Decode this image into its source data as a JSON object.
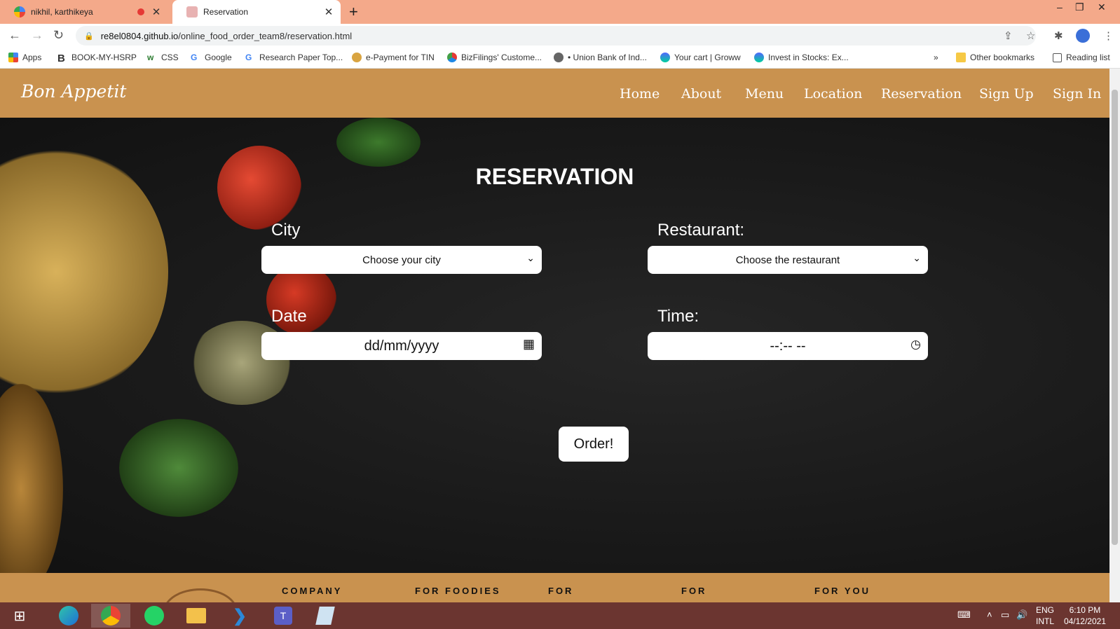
{
  "browser": {
    "tabs": [
      {
        "title": "nikhil, karthikeya",
        "favicon": "google-meet-icon",
        "recording": true
      },
      {
        "title": "Reservation",
        "favicon": "site-favicon-icon",
        "active": true
      }
    ],
    "url_host": "re8el0804.github.io",
    "url_path": "/online_food_order_team8/reservation.html",
    "bookmarks": [
      {
        "label": "Apps",
        "icon": "apps-grid-icon"
      },
      {
        "label": "BOOK-MY-HSRP",
        "icon": "b-logo-icon"
      },
      {
        "label": "CSS",
        "icon": "w3schools-icon"
      },
      {
        "label": "Google",
        "icon": "google-icon"
      },
      {
        "label": "Research Paper Top...",
        "icon": "google-icon"
      },
      {
        "label": "e-Payment for TIN",
        "icon": "tin-icon"
      },
      {
        "label": "BizFilings' Custome...",
        "icon": "bizfilings-icon"
      },
      {
        "label": "• Union Bank of Ind...",
        "icon": "globe-icon"
      },
      {
        "label": "Your cart | Groww",
        "icon": "groww-icon"
      },
      {
        "label": "Invest in Stocks: Ex...",
        "icon": "groww-icon"
      }
    ],
    "other_bookmarks": "Other bookmarks",
    "reading_list": "Reading list",
    "more_chevron": "»"
  },
  "site": {
    "logo": "Bon Appetit",
    "nav": [
      "Home",
      "About",
      "Menu",
      "Location",
      "Reservation",
      "Sign Up",
      "Sign In"
    ],
    "heading": "RESERVATION",
    "city_label": "City",
    "city_value": "Choose your city",
    "restaurant_label": "Restaurant:",
    "restaurant_value": "Choose the restaurant",
    "date_label": "Date",
    "date_value": "dd/mm/yyyy",
    "time_label": "Time:",
    "time_value": "--:-- --",
    "order_button": "Order!",
    "footer_columns": [
      "COMPANY",
      "FOR FOODIES",
      "FOR",
      "FOR",
      "FOR YOU"
    ]
  },
  "taskbar": {
    "apps": [
      "windows-start-icon",
      "edge-icon",
      "chrome-icon",
      "whatsapp-icon",
      "file-explorer-icon",
      "vscode-icon",
      "teams-icon",
      "notepad-icon"
    ],
    "lang_line1": "ENG",
    "lang_line2": "INTL",
    "time": "6:10 PM",
    "date": "04/12/2021"
  }
}
